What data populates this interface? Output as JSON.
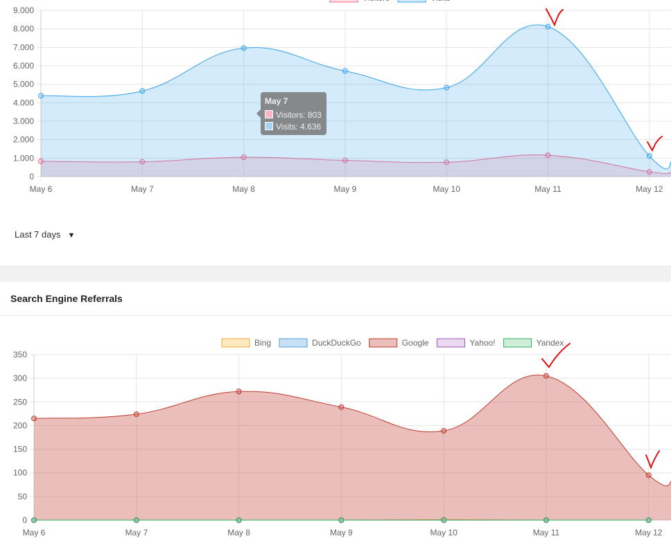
{
  "visits_panel": {
    "range_select": {
      "label": "Last 7 days",
      "caret": "▼"
    },
    "tooltip": {
      "title": "May 7",
      "rows": [
        {
          "text": "Visitors: 803",
          "color": "#ffb3c4"
        },
        {
          "text": "Visits: 4.636",
          "color": "#a9d3f2"
        }
      ]
    }
  },
  "referrals_panel": {
    "title": "Search Engine Referrals"
  },
  "annotations": {
    "check_marks": "red hand-drawn check marks near May 11 and May 12 peaks",
    "color": "#e01010"
  },
  "chart_data": [
    {
      "type": "area",
      "x": [
        "May 6",
        "May 7",
        "May 8",
        "May 9",
        "May 10",
        "May 11",
        "May 12"
      ],
      "ylim": [
        0,
        9000
      ],
      "yticks": [
        "0",
        "1.000",
        "2.000",
        "3.000",
        "4.000",
        "5.000",
        "6.000",
        "7.000",
        "8.000",
        "9.000"
      ],
      "legend": {
        "placement": "top-center",
        "entries": [
          "Visitors",
          "Visits"
        ]
      },
      "grid": true,
      "series": [
        {
          "name": "Visitors",
          "values": [
            830,
            803,
            1050,
            880,
            780,
            1160,
            260
          ],
          "color": "#ff6384",
          "fill": "rgba(255,99,132,0.2)"
        },
        {
          "name": "Visits",
          "values": [
            4380,
            4636,
            6960,
            5720,
            4820,
            8120,
            1120
          ],
          "color": "#36a2eb",
          "fill": "rgba(54,162,235,0.22)"
        }
      ],
      "trailing": {
        "Visitors": 230,
        "Visits": 850
      }
    },
    {
      "type": "area",
      "x": [
        "May 6",
        "May 7",
        "May 8",
        "May 9",
        "May 10",
        "May 11",
        "May 12"
      ],
      "ylim": [
        0,
        350
      ],
      "yticks": [
        "0",
        "50",
        "100",
        "150",
        "200",
        "250",
        "300",
        "350"
      ],
      "legend": {
        "placement": "top-center",
        "entries": [
          "Bing",
          "DuckDuckGo",
          "Google",
          "Yahoo!",
          "Yandex"
        ]
      },
      "grid": true,
      "series": [
        {
          "name": "Bing",
          "values": [
            0,
            0,
            0,
            0,
            1,
            0,
            0
          ],
          "color": "#f0a830",
          "fill": "rgba(255,200,100,0.4)"
        },
        {
          "name": "DuckDuckGo",
          "values": [
            0,
            0,
            0,
            0,
            0,
            0,
            0
          ],
          "color": "#4b9fd8",
          "fill": "rgba(120,180,230,0.4)"
        },
        {
          "name": "Google",
          "values": [
            215,
            224,
            272,
            239,
            189,
            305,
            95
          ],
          "color": "#c0392b",
          "fill": "rgba(205,100,90,0.42)"
        },
        {
          "name": "Yahoo!",
          "values": [
            0,
            0,
            0,
            0,
            0,
            0,
            0
          ],
          "color": "#9b59b6",
          "fill": "rgba(200,160,220,0.4)"
        },
        {
          "name": "Yandex",
          "values": [
            0,
            0,
            0,
            0,
            0,
            0,
            0
          ],
          "color": "#27ae60",
          "fill": "rgba(140,210,160,0.4)"
        }
      ],
      "trailing": {
        "Google": 83
      }
    }
  ]
}
